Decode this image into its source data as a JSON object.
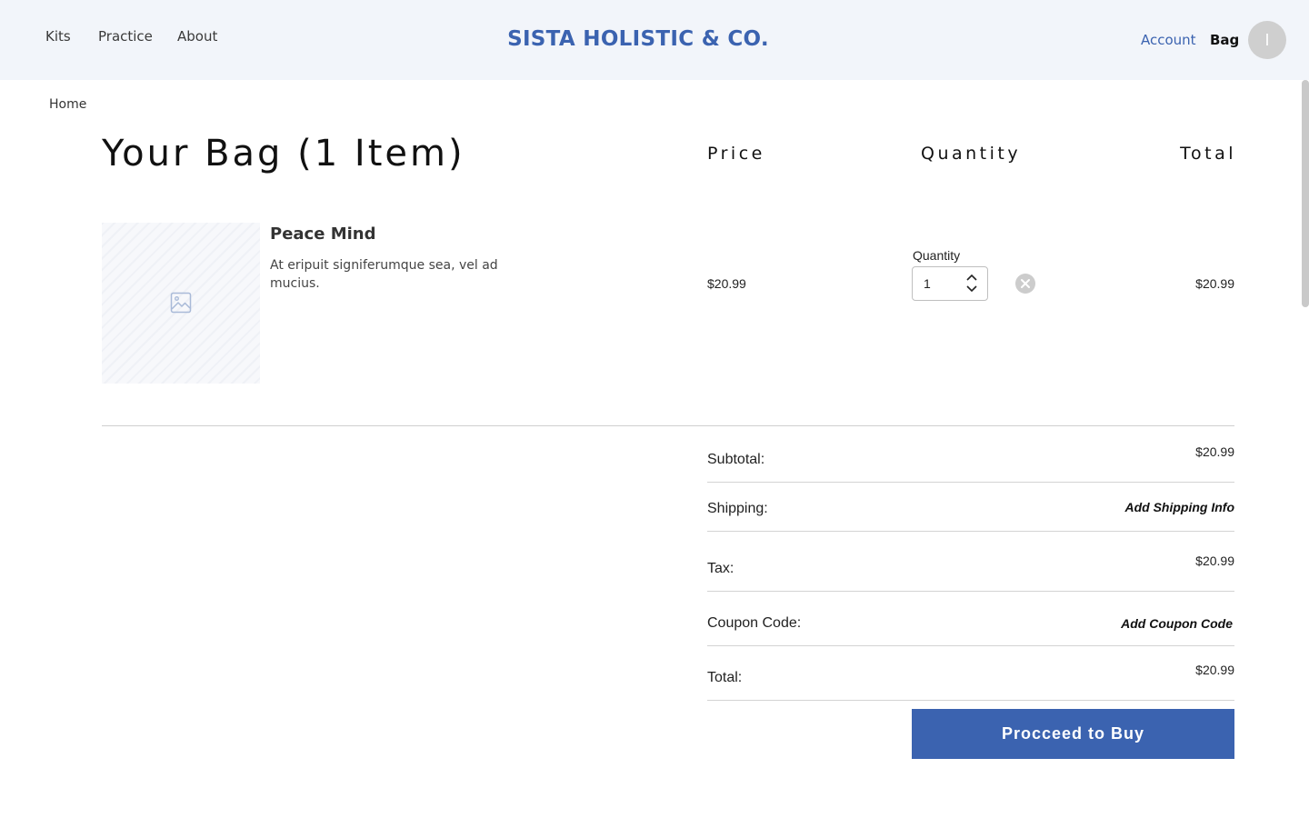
{
  "header": {
    "nav": [
      "Kits",
      "Practice",
      "About"
    ],
    "brand": "SISTA HOLISTIC & CO.",
    "account_label": "Account",
    "bag_label": "Bag",
    "avatar_initial": "I"
  },
  "breadcrumb": {
    "home": "Home"
  },
  "bag": {
    "title": "Your Bag (1 Item)",
    "columns": {
      "price": "Price",
      "quantity": "Quantity",
      "total": "Total"
    },
    "items": [
      {
        "name": "Peace Mind",
        "description": "At eripuit signiferumque sea, vel ad mucius.",
        "image_icon": "image-placeholder-icon",
        "price": "$20.99",
        "quantity_label": "Quantity",
        "quantity": "1",
        "total": "$20.99"
      }
    ]
  },
  "summary": {
    "subtotal_label": "Subtotal:",
    "subtotal_value": "$20.99",
    "shipping_label": "Shipping:",
    "shipping_action": "Add Shipping Info",
    "tax_label": "Tax:",
    "tax_value": "$20.99",
    "coupon_label": "Coupon Code:",
    "coupon_action": "Add Coupon Code",
    "total_label": "Total:",
    "total_value": "$20.99",
    "buy_label": "Procceed to Buy"
  },
  "colors": {
    "brand": "#3b63b0",
    "header_bg": "#f2f5fa",
    "button_bg": "#3b63b0",
    "remove_icon": "#cccccc"
  }
}
